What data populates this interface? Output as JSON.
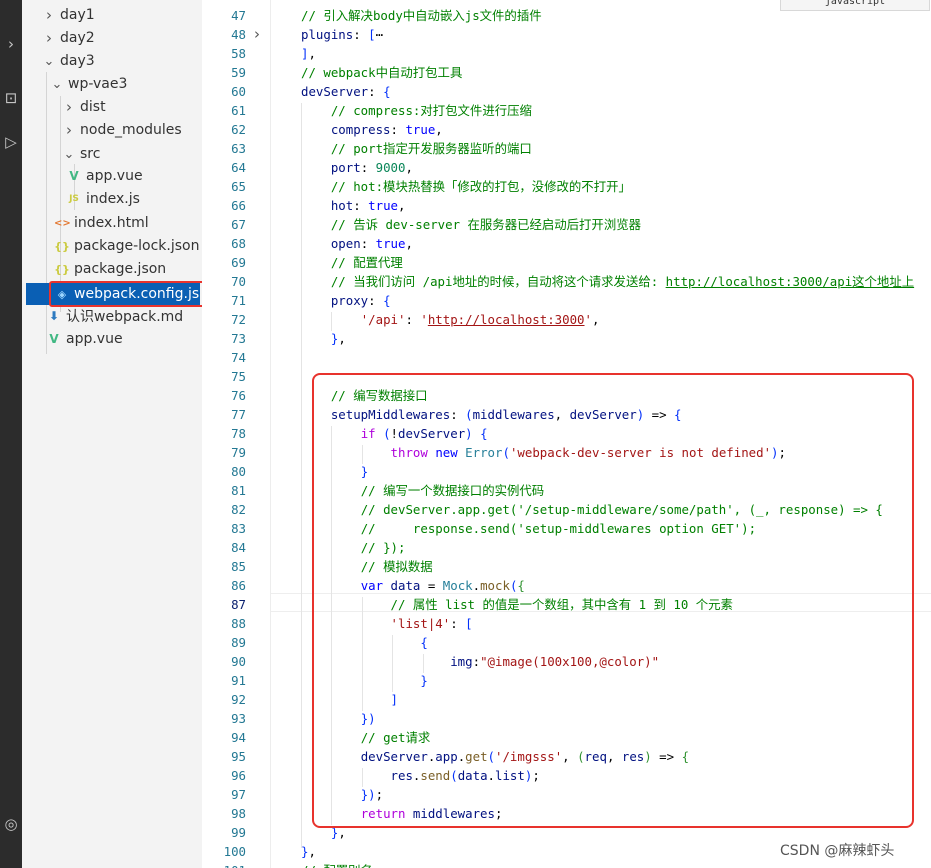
{
  "explorer": {
    "items": [
      {
        "label": "day1",
        "kind": "folder",
        "expanded": false,
        "icon": "chevron-right-icon"
      },
      {
        "label": "day2",
        "kind": "folder",
        "expanded": false,
        "icon": "chevron-right-icon"
      },
      {
        "label": "day3",
        "kind": "folder",
        "expanded": true,
        "icon": "chevron-down-icon"
      },
      {
        "label": "wp-vae3",
        "kind": "folder",
        "expanded": true,
        "icon": "chevron-down-icon"
      },
      {
        "label": "dist",
        "kind": "folder",
        "expanded": false,
        "icon": "chevron-right-icon"
      },
      {
        "label": "node_modules",
        "kind": "folder",
        "expanded": false,
        "icon": "chevron-right-icon"
      },
      {
        "label": "src",
        "kind": "folder",
        "expanded": true,
        "icon": "chevron-down-icon"
      },
      {
        "label": "app.vue",
        "kind": "file",
        "icon": "vue-file-icon"
      },
      {
        "label": "index.js",
        "kind": "file",
        "icon": "js-file-icon"
      },
      {
        "label": "index.html",
        "kind": "file",
        "icon": "html-file-icon"
      },
      {
        "label": "package-lock.json",
        "kind": "file",
        "icon": "json-file-icon"
      },
      {
        "label": "package.json",
        "kind": "file",
        "icon": "json-file-icon"
      },
      {
        "label": "webpack.config.js",
        "kind": "file",
        "icon": "webpack-file-icon",
        "selected": true
      },
      {
        "label": "认识webpack.md",
        "kind": "file",
        "icon": "markdown-file-icon"
      },
      {
        "label": "app.vue",
        "kind": "file",
        "icon": "vue-file-icon"
      }
    ]
  },
  "editor": {
    "language_indicator": "javascript",
    "active_line": "87",
    "lines": [
      {
        "n": "47",
        "text": "// 引入解决body中自动嵌入js文件的插件"
      },
      {
        "n": "48",
        "text": "plugins: [⋯",
        "folded": true
      },
      {
        "n": "58",
        "text": "],"
      },
      {
        "n": "59",
        "text": "// webpack中自动打包工具"
      },
      {
        "n": "60",
        "text": "devServer: {"
      },
      {
        "n": "61",
        "text": "    // compress:对打包文件进行压缩"
      },
      {
        "n": "62",
        "text": "    compress: true,"
      },
      {
        "n": "63",
        "text": "    // port指定开发服务器监听的端口"
      },
      {
        "n": "64",
        "text": "    port: 9000,"
      },
      {
        "n": "65",
        "text": "    // hot:模块热替换「修改的打包，没修改的不打开」"
      },
      {
        "n": "66",
        "text": "    hot: true,"
      },
      {
        "n": "67",
        "text": "    // 告诉 dev-server 在服务器已经启动后打开浏览器"
      },
      {
        "n": "68",
        "text": "    open: true,"
      },
      {
        "n": "69",
        "text": "    // 配置代理"
      },
      {
        "n": "70",
        "text": "    // 当我们访问 /api地址的时候，自动将这个请求发送给: http://localhost:3000/api这个地址上"
      },
      {
        "n": "71",
        "text": "    proxy: {"
      },
      {
        "n": "72",
        "text": "        '/api': 'http://localhost:3000',"
      },
      {
        "n": "73",
        "text": "    },"
      },
      {
        "n": "74",
        "text": ""
      },
      {
        "n": "75",
        "text": ""
      },
      {
        "n": "76",
        "text": "    // 编写数据接口"
      },
      {
        "n": "77",
        "text": "    setupMiddlewares: (middlewares, devServer) => {"
      },
      {
        "n": "78",
        "text": "        if (!devServer) {"
      },
      {
        "n": "79",
        "text": "            throw new Error('webpack-dev-server is not defined');"
      },
      {
        "n": "80",
        "text": "        }"
      },
      {
        "n": "81",
        "text": "        // 编写一个数据接口的实例代码"
      },
      {
        "n": "82",
        "text": "        // devServer.app.get('/setup-middleware/some/path', (_, response) => {"
      },
      {
        "n": "83",
        "text": "        //     response.send('setup-middlewares option GET');"
      },
      {
        "n": "84",
        "text": "        // });"
      },
      {
        "n": "85",
        "text": "        // 模拟数据"
      },
      {
        "n": "86",
        "text": "        var data = Mock.mock({"
      },
      {
        "n": "87",
        "text": "            // 属性 list 的值是一个数组，其中含有 1 到 10 个元素"
      },
      {
        "n": "88",
        "text": "            'list|4': ["
      },
      {
        "n": "89",
        "text": "                {"
      },
      {
        "n": "90",
        "text": "                    img:\"@image(100x100,@color)\""
      },
      {
        "n": "91",
        "text": "                }"
      },
      {
        "n": "92",
        "text": "            ]"
      },
      {
        "n": "93",
        "text": "        })"
      },
      {
        "n": "94",
        "text": "        // get请求"
      },
      {
        "n": "95",
        "text": "        devServer.app.get('/imgsss', (req, res) => {"
      },
      {
        "n": "96",
        "text": "            res.send(data.list);"
      },
      {
        "n": "97",
        "text": "        });"
      },
      {
        "n": "98",
        "text": "        return middlewares;"
      },
      {
        "n": "99",
        "text": "    },"
      },
      {
        "n": "100",
        "text": "},"
      },
      {
        "n": "101",
        "text": "// 配置别名"
      }
    ]
  },
  "watermark": "CSDN @麻辣虾头",
  "colors": {
    "annotation_red": "#e8332d",
    "selection_blue": "#0a5fb4",
    "comment_green": "#008000",
    "keyword_blue": "#0000ff",
    "string_red": "#a31515"
  }
}
